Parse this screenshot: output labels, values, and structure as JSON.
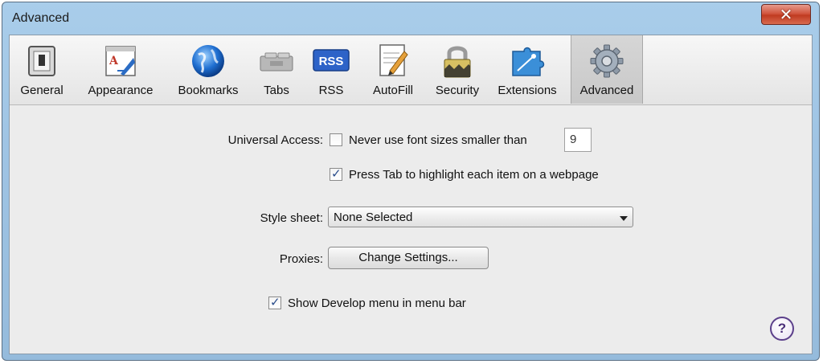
{
  "window": {
    "title": "Advanced",
    "close_icon": "close-icon"
  },
  "toolbar": {
    "items": [
      {
        "label": "General",
        "icon": "general-switch-icon"
      },
      {
        "label": "Appearance",
        "icon": "appearance-font-icon"
      },
      {
        "label": "Bookmarks",
        "icon": "globe-icon"
      },
      {
        "label": "Tabs",
        "icon": "tabs-icon"
      },
      {
        "label": "RSS",
        "icon": "rss-icon"
      },
      {
        "label": "AutoFill",
        "icon": "autofill-pencil-icon"
      },
      {
        "label": "Security",
        "icon": "padlock-icon"
      },
      {
        "label": "Extensions",
        "icon": "puzzle-icon"
      },
      {
        "label": "Advanced",
        "icon": "gear-icon"
      }
    ],
    "selected": "Advanced"
  },
  "form": {
    "universal_access_label": "Universal Access:",
    "font_size_option": "Never use font sizes smaller than",
    "font_size_checked": false,
    "font_size_value": "9",
    "tab_highlight_option": "Press Tab to highlight each item on a webpage",
    "tab_highlight_checked": true,
    "style_sheet_label": "Style sheet:",
    "style_sheet_value": "None Selected",
    "proxies_label": "Proxies:",
    "proxies_button": "Change Settings...",
    "develop_menu_option": "Show Develop menu in menu bar",
    "develop_menu_checked": true,
    "help_glyph": "?"
  },
  "colors": {
    "title_bar": "#a9cdea",
    "close_button": "#c03b21",
    "check_tick": "#2a4d8c"
  }
}
